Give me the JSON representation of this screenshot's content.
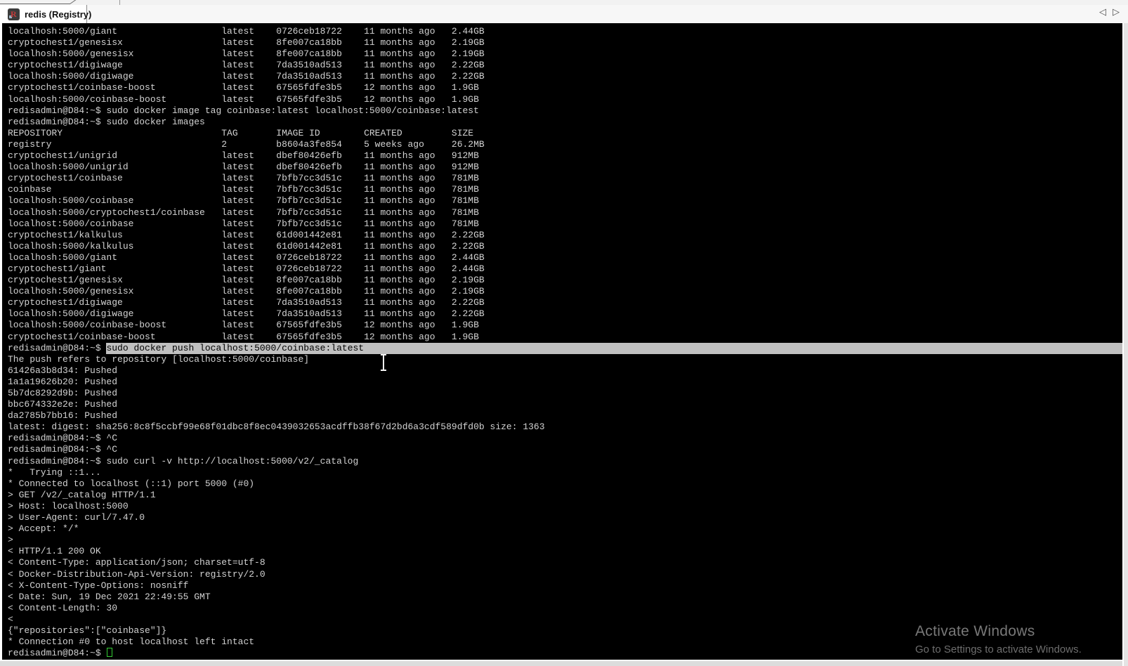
{
  "tab_bar": {
    "tab": {
      "title": "redis (Registry)",
      "icon_letter": "R"
    },
    "nav": {
      "left": "◁",
      "right": "▷"
    }
  },
  "terminal": {
    "prompt": "redisadmin@D84:~$",
    "columns": {
      "repo": 39,
      "tag": 10,
      "id": 16,
      "created": 16
    },
    "header": {
      "repo": "REPOSITORY",
      "tag": "TAG",
      "id": "IMAGE ID",
      "created": "CREATED",
      "size": "SIZE"
    },
    "lines": [
      {
        "type": "row",
        "repo": "localhosh:5000/giant",
        "tag": "latest",
        "id": "0726ceb18722",
        "created": "11 months ago",
        "size": "2.44GB"
      },
      {
        "type": "row",
        "repo": "cryptochest1/genesisx",
        "tag": "latest",
        "id": "8fe007ca18bb",
        "created": "11 months ago",
        "size": "2.19GB"
      },
      {
        "type": "row",
        "repo": "localhosh:5000/genesisx",
        "tag": "latest",
        "id": "8fe007ca18bb",
        "created": "11 months ago",
        "size": "2.19GB"
      },
      {
        "type": "row",
        "repo": "cryptochest1/digiwage",
        "tag": "latest",
        "id": "7da3510ad513",
        "created": "11 months ago",
        "size": "2.22GB"
      },
      {
        "type": "row",
        "repo": "localhosh:5000/digiwage",
        "tag": "latest",
        "id": "7da3510ad513",
        "created": "11 months ago",
        "size": "2.22GB"
      },
      {
        "type": "row",
        "repo": "cryptochest1/coinbase-boost",
        "tag": "latest",
        "id": "67565fdfe3b5",
        "created": "12 months ago",
        "size": "1.9GB"
      },
      {
        "type": "row",
        "repo": "localhosh:5000/coinbase-boost",
        "tag": "latest",
        "id": "67565fdfe3b5",
        "created": "12 months ago",
        "size": "1.9GB"
      },
      {
        "type": "prompt",
        "cmd": "sudo docker image tag coinbase:latest localhost:5000/coinbase:latest"
      },
      {
        "type": "prompt",
        "cmd": "sudo docker images"
      },
      {
        "type": "header"
      },
      {
        "type": "row",
        "repo": "registry",
        "tag": "2",
        "id": "b8604a3fe854",
        "created": "5 weeks ago",
        "size": "26.2MB"
      },
      {
        "type": "row",
        "repo": "cryptochest1/unigrid",
        "tag": "latest",
        "id": "dbef80426efb",
        "created": "11 months ago",
        "size": "912MB"
      },
      {
        "type": "row",
        "repo": "localhosh:5000/unigrid",
        "tag": "latest",
        "id": "dbef80426efb",
        "created": "11 months ago",
        "size": "912MB"
      },
      {
        "type": "row",
        "repo": "cryptochest1/coinbase",
        "tag": "latest",
        "id": "7bfb7cc3d51c",
        "created": "11 months ago",
        "size": "781MB"
      },
      {
        "type": "row",
        "repo": "coinbase",
        "tag": "latest",
        "id": "7bfb7cc3d51c",
        "created": "11 months ago",
        "size": "781MB"
      },
      {
        "type": "row",
        "repo": "localhosh:5000/coinbase",
        "tag": "latest",
        "id": "7bfb7cc3d51c",
        "created": "11 months ago",
        "size": "781MB"
      },
      {
        "type": "row",
        "repo": "localhosh:5000/cryptochest1/coinbase",
        "tag": "latest",
        "id": "7bfb7cc3d51c",
        "created": "11 months ago",
        "size": "781MB"
      },
      {
        "type": "row",
        "repo": "localhost:5000/coinbase",
        "tag": "latest",
        "id": "7bfb7cc3d51c",
        "created": "11 months ago",
        "size": "781MB"
      },
      {
        "type": "row",
        "repo": "cryptochest1/kalkulus",
        "tag": "latest",
        "id": "61d001442e81",
        "created": "11 months ago",
        "size": "2.22GB"
      },
      {
        "type": "row",
        "repo": "localhosh:5000/kalkulus",
        "tag": "latest",
        "id": "61d001442e81",
        "created": "11 months ago",
        "size": "2.22GB"
      },
      {
        "type": "row",
        "repo": "localhosh:5000/giant",
        "tag": "latest",
        "id": "0726ceb18722",
        "created": "11 months ago",
        "size": "2.44GB"
      },
      {
        "type": "row",
        "repo": "cryptochest1/giant",
        "tag": "latest",
        "id": "0726ceb18722",
        "created": "11 months ago",
        "size": "2.44GB"
      },
      {
        "type": "row",
        "repo": "cryptochest1/genesisx",
        "tag": "latest",
        "id": "8fe007ca18bb",
        "created": "11 months ago",
        "size": "2.19GB"
      },
      {
        "type": "row",
        "repo": "localhosh:5000/genesisx",
        "tag": "latest",
        "id": "8fe007ca18bb",
        "created": "11 months ago",
        "size": "2.19GB"
      },
      {
        "type": "row",
        "repo": "cryptochest1/digiwage",
        "tag": "latest",
        "id": "7da3510ad513",
        "created": "11 months ago",
        "size": "2.22GB"
      },
      {
        "type": "row",
        "repo": "localhosh:5000/digiwage",
        "tag": "latest",
        "id": "7da3510ad513",
        "created": "11 months ago",
        "size": "2.22GB"
      },
      {
        "type": "row",
        "repo": "localhosh:5000/coinbase-boost",
        "tag": "latest",
        "id": "67565fdfe3b5",
        "created": "12 months ago",
        "size": "1.9GB"
      },
      {
        "type": "row",
        "repo": "cryptochest1/coinbase-boost",
        "tag": "latest",
        "id": "67565fdfe3b5",
        "created": "12 months ago",
        "size": "1.9GB"
      },
      {
        "type": "prompt-sel",
        "cmd": "sudo docker push localhost:5000/coinbase:latest"
      },
      {
        "type": "text",
        "text": "The push refers to repository [localhost:5000/coinbase]"
      },
      {
        "type": "text",
        "text": "61426a3b8d34: Pushed"
      },
      {
        "type": "text",
        "text": "1a1a19626b20: Pushed"
      },
      {
        "type": "text",
        "text": "5b7dc8292d9b: Pushed"
      },
      {
        "type": "text",
        "text": "bbc674332e2e: Pushed"
      },
      {
        "type": "text",
        "text": "da2785b7bb16: Pushed"
      },
      {
        "type": "text",
        "text": "latest: digest: sha256:8c8f5ccbf99e68f01dbc8f8ec0439032653acdffb38f67d2bd6a3cdf589dfd0b size: 1363"
      },
      {
        "type": "prompt",
        "cmd": "^C"
      },
      {
        "type": "prompt",
        "cmd": "^C"
      },
      {
        "type": "prompt",
        "cmd": "sudo curl -v http://localhost:5000/v2/_catalog"
      },
      {
        "type": "text",
        "text": "*   Trying ::1..."
      },
      {
        "type": "text",
        "text": "* Connected to localhost (::1) port 5000 (#0)"
      },
      {
        "type": "text",
        "text": "> GET /v2/_catalog HTTP/1.1"
      },
      {
        "type": "text",
        "text": "> Host: localhost:5000"
      },
      {
        "type": "text",
        "text": "> User-Agent: curl/7.47.0"
      },
      {
        "type": "text",
        "text": "> Accept: */*"
      },
      {
        "type": "text",
        "text": ">"
      },
      {
        "type": "text",
        "text": "< HTTP/1.1 200 OK"
      },
      {
        "type": "text",
        "text": "< Content-Type: application/json; charset=utf-8"
      },
      {
        "type": "text",
        "text": "< Docker-Distribution-Api-Version: registry/2.0"
      },
      {
        "type": "text",
        "text": "< X-Content-Type-Options: nosniff"
      },
      {
        "type": "text",
        "text": "< Date: Sun, 19 Dec 2021 22:49:55 GMT"
      },
      {
        "type": "text",
        "text": "< Content-Length: 30"
      },
      {
        "type": "text",
        "text": "<"
      },
      {
        "type": "text",
        "text": "{\"repositories\":[\"coinbase\"]}"
      },
      {
        "type": "text",
        "text": "* Connection #0 to host localhost left intact"
      },
      {
        "type": "prompt-cursor"
      }
    ]
  },
  "watermark": {
    "title": "Activate Windows",
    "subtitle": "Go to Settings to activate Windows."
  },
  "colors": {
    "terminal_bg": "#000000",
    "terminal_fg": "#d2d2d2",
    "selection_bg": "#c0c0c0",
    "selection_fg": "#000000",
    "cursor_green": "#35cd35",
    "chrome_bg": "#f7f7f7"
  }
}
